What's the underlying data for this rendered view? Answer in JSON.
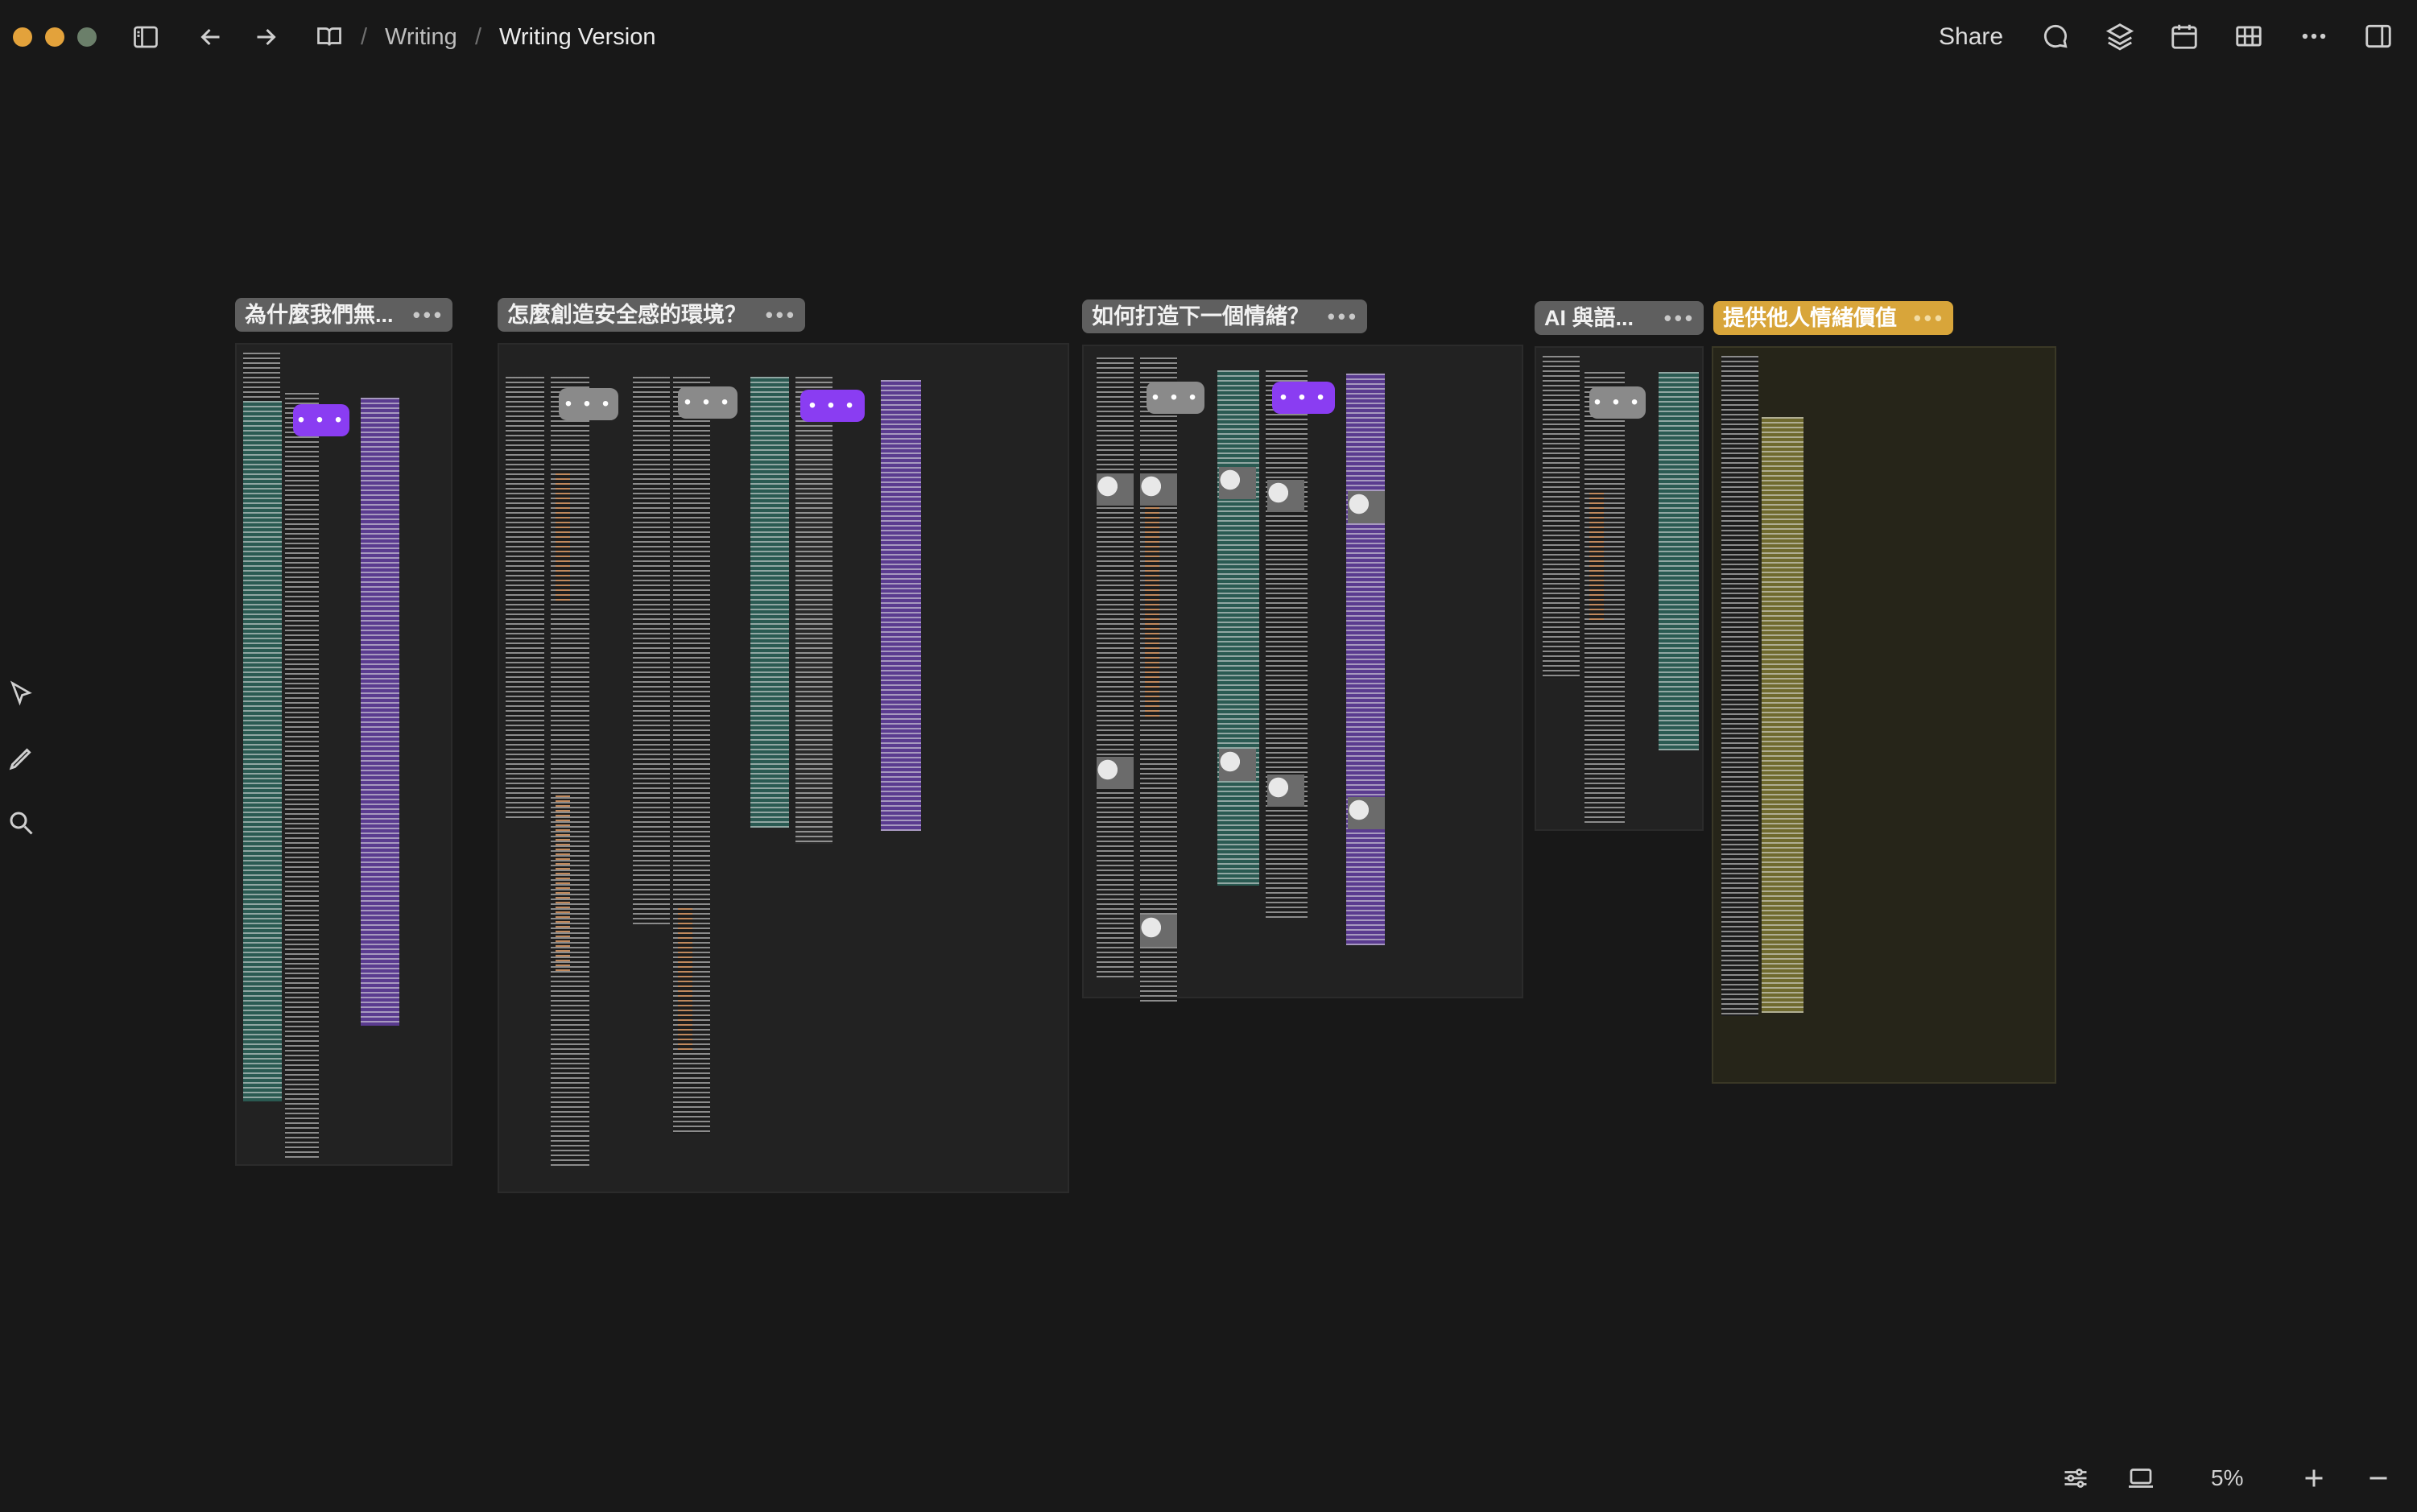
{
  "window": {
    "traffic_colors": [
      "#e3a23b",
      "#e3a23b",
      "#6b7f6a"
    ]
  },
  "breadcrumb": {
    "parent": "Writing",
    "separator": "/",
    "current": "Writing Version"
  },
  "header": {
    "share_label": "Share"
  },
  "canvas": {
    "frames": [
      {
        "title": "為什麼我們無...",
        "color": "#5f5f5f"
      },
      {
        "title": "怎麼創造安全感的環境？",
        "color": "#5f5f5f"
      },
      {
        "title": "如何打造下一個情緒？",
        "color": "#5f5f5f"
      },
      {
        "title": "AI 與語...",
        "color": "#5f5f5f"
      },
      {
        "title": "提供他人情緒價值",
        "color": "#d8a53a"
      }
    ],
    "bubble_label": "• • •"
  },
  "tools": {
    "items": [
      "select-icon",
      "pen-icon",
      "search-icon"
    ]
  },
  "footer": {
    "zoom": "5%"
  }
}
